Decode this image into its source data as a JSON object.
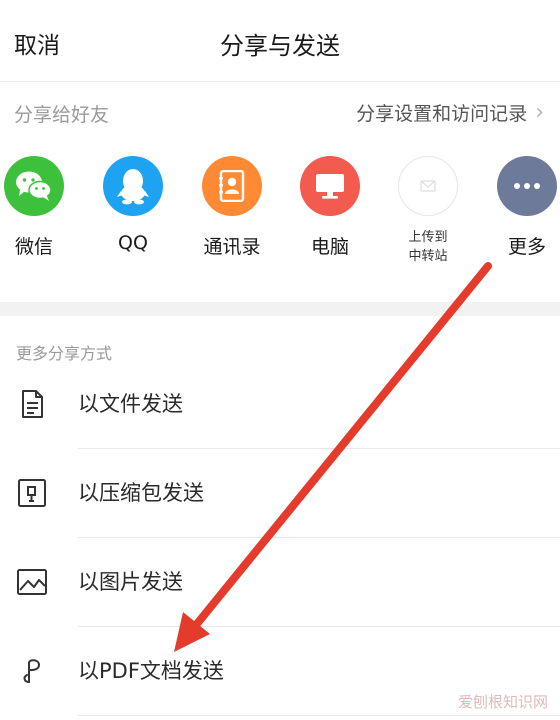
{
  "header": {
    "cancel_label": "取消",
    "title": "分享与发送"
  },
  "subbar": {
    "left_label": "分享给好友",
    "right_label": "分享设置和访问记录",
    "chevron": "›"
  },
  "apps": [
    {
      "label": "微信",
      "icon": "wechat-icon",
      "color": "#3DC13C"
    },
    {
      "label": "QQ",
      "icon": "qq-icon",
      "color": "#1EA3F3"
    },
    {
      "label": "通讯录",
      "icon": "contacts-icon",
      "color": "#FF8A33"
    },
    {
      "label": "电脑",
      "icon": "computer-icon",
      "color": "#F25B4E"
    },
    {
      "label_line1": "上传到",
      "label_line2": "中转站",
      "icon": "upload-transfer-icon",
      "color": "#ffffff"
    },
    {
      "label": "更多",
      "icon": "more-icon",
      "color": "#6E7A99"
    }
  ],
  "more": {
    "title": "更多分享方式",
    "items": [
      {
        "label": "以文件发送",
        "icon": "document-icon"
      },
      {
        "label": "以压缩包发送",
        "icon": "zip-icon"
      },
      {
        "label": "以图片发送",
        "icon": "image-icon"
      },
      {
        "label": "以PDF文档发送",
        "icon": "pdf-icon"
      }
    ]
  },
  "annotation": {
    "arrow_color": "#E53B2C"
  },
  "watermark": "爱刨根知识网"
}
